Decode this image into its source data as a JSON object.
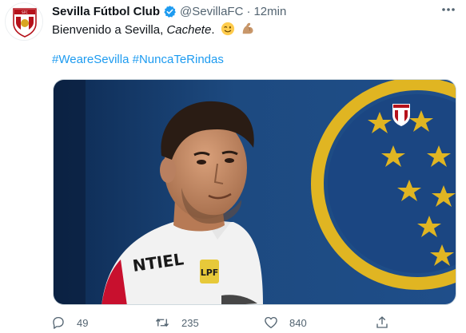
{
  "tweet": {
    "author_name": "Sevilla Fútbol Club",
    "handle": "@SevillaFC",
    "separator": "·",
    "time": "12min",
    "text_main": "Bienvenido a Sevilla, ",
    "text_emph": "Cachete",
    "text_end": ".",
    "emojis": [
      "winking-face-emoji",
      "flexed-biceps-emoji"
    ],
    "hashtags": [
      "#WeareSevilla",
      "#NuncaTeRindas"
    ],
    "media": {
      "alt": "player photo",
      "jersey_text": "NTIEL",
      "badge_text": "LPF"
    },
    "actions": {
      "reply_count": "49",
      "retweet_count": "235",
      "like_count": "840"
    },
    "colors": {
      "link": "#1d9bf0",
      "muted": "#536471",
      "verified": "#1d9bf0"
    }
  }
}
